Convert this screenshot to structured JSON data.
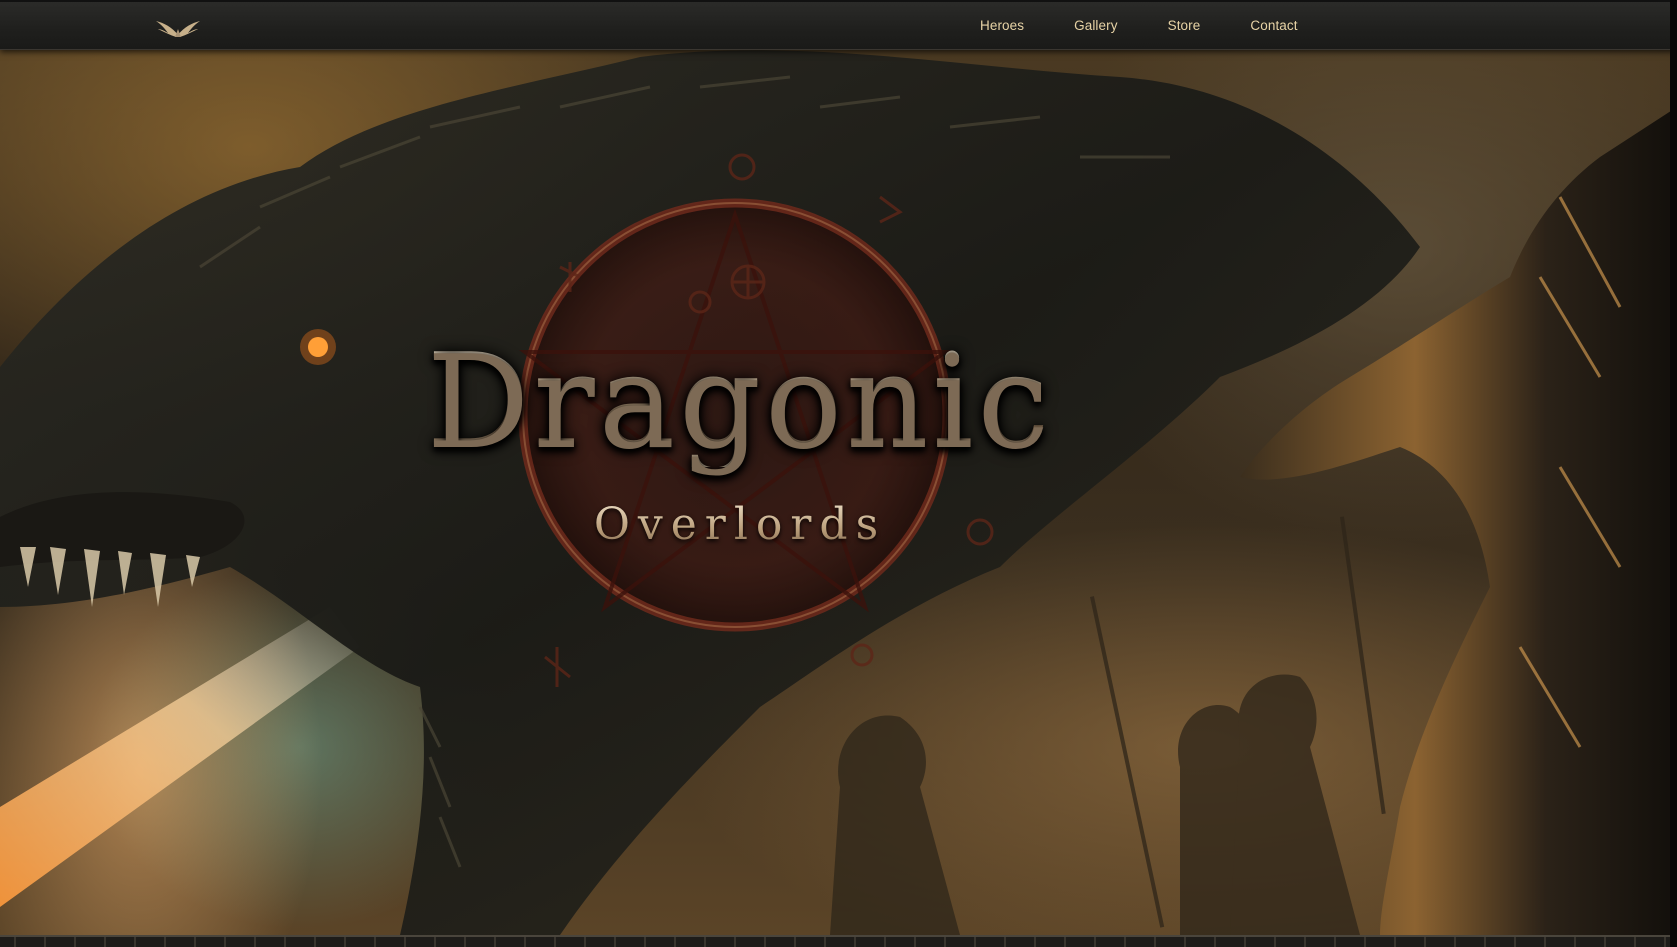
{
  "nav": {
    "logo_icon": "winged-emblem-icon",
    "links": [
      {
        "label": "Heroes"
      },
      {
        "label": "Gallery"
      },
      {
        "label": "Store"
      },
      {
        "label": "Contact"
      }
    ]
  },
  "hero": {
    "title": "Dragonic",
    "subtitle": "Overlords",
    "emblem_icon": "pentagram-sigil-icon"
  },
  "colors": {
    "nav_text": "#e7d3a6",
    "nav_bg": "#1f1f1d",
    "title_metal": "#d4c2a8",
    "sigil_red": "#6a1a14"
  }
}
